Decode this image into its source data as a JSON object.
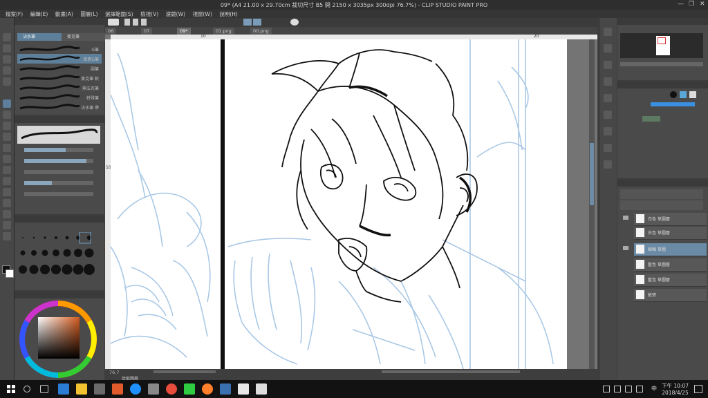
{
  "window": {
    "title": "09* (A4 21.00 x 29.70cm 裁切尺寸 B5 開 2150 x 3035px 300dpi 76.7%) - CLIP STUDIO PAINT PRO"
  },
  "menu": [
    "檔案(F)",
    "編輯(E)",
    "動畫(A)",
    "圖層(L)",
    "選擇範圍(S)",
    "檢視(V)",
    "濾鏡(W)",
    "視窗(W)",
    "說明(H)"
  ],
  "doc_tabs": [
    {
      "label": "06"
    },
    {
      "label": "07"
    },
    {
      "label": "09*",
      "active": true
    },
    {
      "label": "01.png"
    },
    {
      "label": "00.png"
    }
  ],
  "ruler": {
    "marks": [
      "10",
      "20"
    ],
    "vmark": "10"
  },
  "subtool": {
    "tabs": [
      "沾水筆",
      "麥克筆"
    ],
    "brushes": [
      "G筆",
      "真實G筆",
      "圓筆",
      "麥克筆 軟",
      "無法克筆",
      "特殊筆",
      "沾水筆 帶",
      "粗細筆"
    ]
  },
  "layers": {
    "items": [
      {
        "name": "白色 草圖層"
      },
      {
        "name": "白色 草圖層"
      },
      {
        "name": "線稿 草圖",
        "selected": true
      },
      {
        "name": "藍色 草圖層"
      },
      {
        "name": "藍色 草圖層"
      },
      {
        "name": "紙張"
      }
    ]
  },
  "canvas": {
    "status": "拾取圖層",
    "zoom": "76.7"
  },
  "taskbar": {
    "time": "下午 10:07",
    "date": "2018/4/25",
    "ime": "中",
    "apps": [
      "start-icon",
      "search-icon",
      "taskview-icon",
      "edge-icon",
      "explorer-icon",
      "store-icon",
      "antivirus-icon",
      "ie-icon",
      "mail-icon",
      "chrome-icon",
      "line-icon",
      "firefox-icon",
      "remote-icon",
      "csp-icon",
      "photos-icon"
    ]
  },
  "colors": {
    "accent": "#5e7f99",
    "sketch_blue": "#a9c8e6",
    "line_black": "#111111"
  }
}
